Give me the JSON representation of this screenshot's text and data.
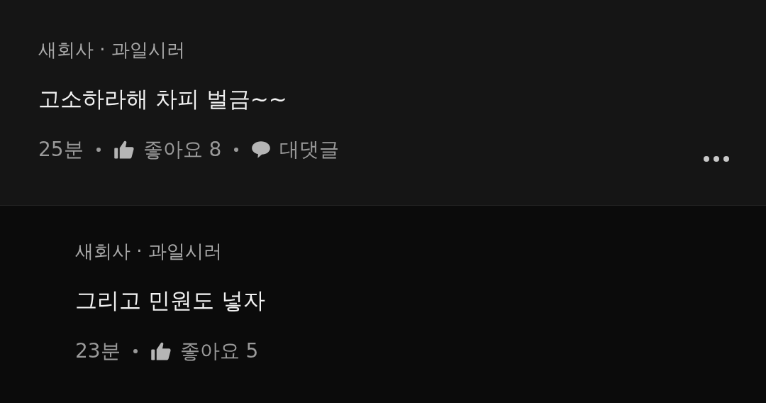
{
  "comments": [
    {
      "author": "새회사 · 과일시러",
      "text": "고소하라해 차피 벌금~~",
      "time": "25분",
      "like_label": "좋아요 8",
      "reply_label": "대댓글",
      "is_reply": false,
      "has_menu": true
    },
    {
      "author": "새회사 · 과일시러",
      "text": "그리고 민원도 넣자",
      "time": "23분",
      "like_label": "좋아요 5",
      "is_reply": true,
      "has_menu": false
    }
  ]
}
